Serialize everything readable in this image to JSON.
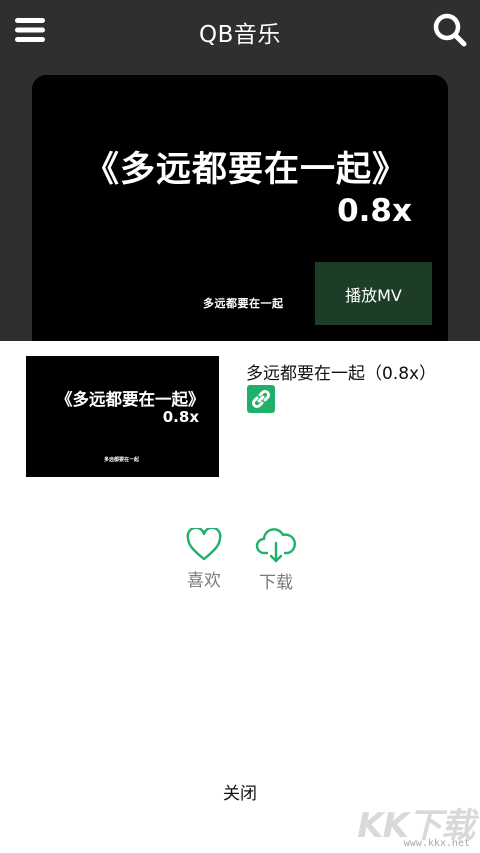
{
  "header": {
    "title": "QB音乐",
    "menu_icon": "hamburger-menu-icon",
    "search_icon": "search-icon"
  },
  "poster": {
    "title": "《多远都要在一起》",
    "speed": "0.8x",
    "small_title": "多远都要在一起",
    "play_mv_label": "播放MV"
  },
  "song": {
    "name": "多远都要在一起（0.8x）",
    "thumb_title": "《多远都要在一起》",
    "thumb_speed": "0.8x",
    "thumb_small": "多远都要在一起",
    "link_icon": "link-icon"
  },
  "actions": {
    "like_label": "喜欢",
    "download_label": "下载"
  },
  "footer": {
    "close_label": "关闭"
  },
  "watermark": {
    "text": "KK下载",
    "url": "www.kkx.net"
  },
  "colors": {
    "header_bg": "#2f2f2f",
    "accent_green": "#1fb06a",
    "play_mv_bg": "#1d3d26"
  }
}
